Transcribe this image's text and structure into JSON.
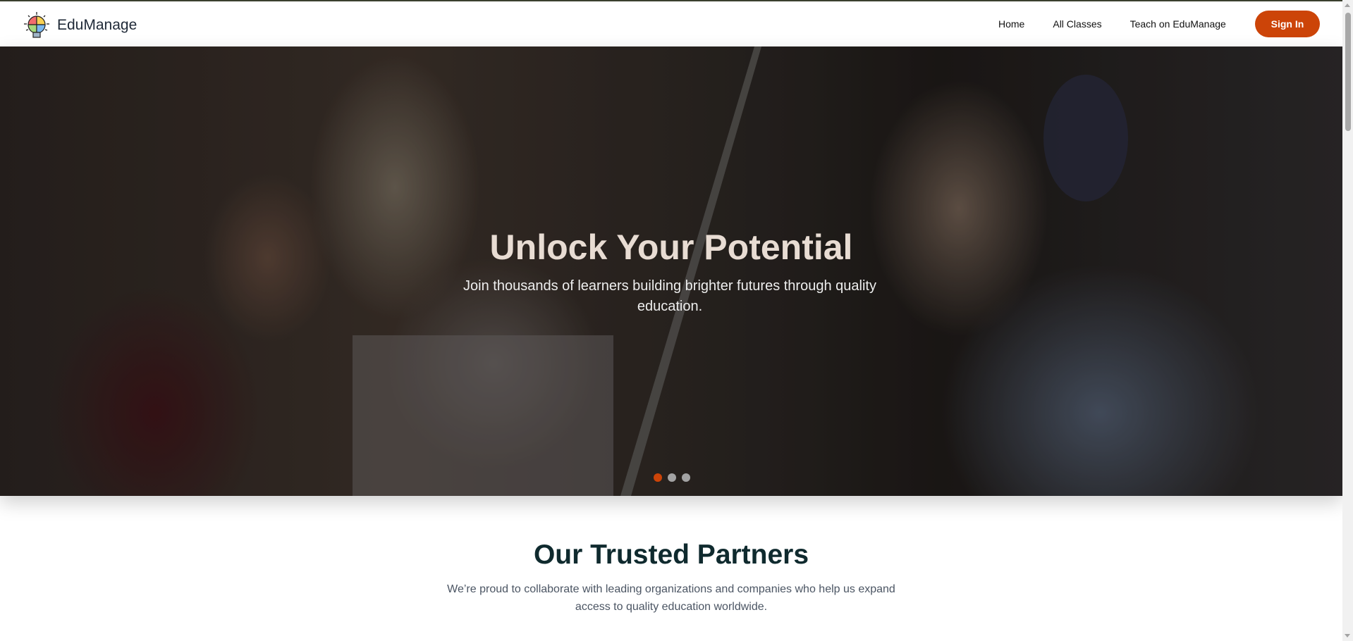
{
  "brand": {
    "name": "EduManage",
    "logo_icon": "lightbulb-puzzle-icon"
  },
  "nav": {
    "links": [
      "Home",
      "All Classes",
      "Teach on EduManage"
    ],
    "sign_in": "Sign In"
  },
  "hero": {
    "title": "Unlock Your Potential",
    "subtitle": "Join thousands of learners building brighter futures through quality education.",
    "slides": 3,
    "active_slide": 1
  },
  "partners": {
    "title": "Our Trusted Partners",
    "description": "We’re proud to collaborate with leading organizations and companies who help us expand access to quality education worldwide."
  },
  "colors": {
    "accent": "#cc4408",
    "heading": "#0f2a2e",
    "body_text": "#4b5563"
  }
}
